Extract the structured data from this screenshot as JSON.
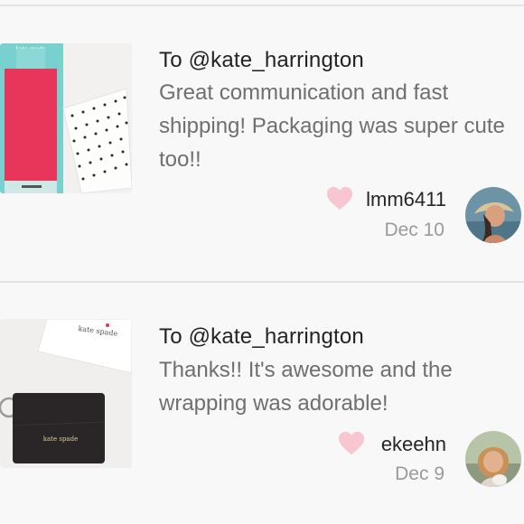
{
  "reviews": [
    {
      "recipient": "To @kate_harrington",
      "message": "Great communication and fast shipping! Packaging was super cute too!!",
      "username": "lmm6411",
      "date": "Dec 10",
      "product_icon": "phone-case-product-image",
      "avatar_icon": "user-avatar"
    },
    {
      "recipient": "To @kate_harrington",
      "message": "Thanks!! It's awesome and the wrapping was adorable!",
      "username": "ekeehn",
      "date": "Dec 9",
      "product_icon": "wallet-product-image",
      "avatar_icon": "user-avatar"
    }
  ],
  "colors": {
    "background": "#f9f8f9",
    "heart": "#f7c6d0",
    "title_text": "#232323",
    "message_text": "#6f6f6f",
    "date_text": "#9a9a9a",
    "divider": "#e4e2e4"
  }
}
